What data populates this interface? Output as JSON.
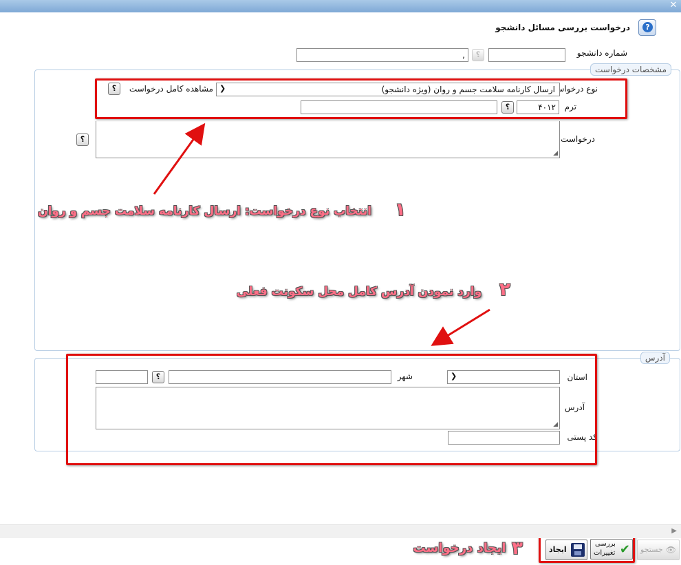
{
  "window": {
    "title": "درخواست بررسی مسائل دانشجو",
    "close_icon": "close-icon"
  },
  "student": {
    "label": "شماره دانشجو",
    "comma": ","
  },
  "request_section": {
    "legend": "مشخصات درخواست",
    "type_label": "نوع درخواست",
    "type_value": "ارسال کارنامه سلامت جسم و روان (ویژه دانشجو)",
    "view_full_label": "مشاهده کامل درخواست",
    "term_label": "ترم",
    "term_value": "۴۰۱۲",
    "first_request_label": "درخواست اول"
  },
  "address_section": {
    "legend": "آدرس",
    "province_label": "استان",
    "city_label": "شهر",
    "address_label": "آدرس",
    "postal_label": "کد پستی"
  },
  "annotations": {
    "step1_num": "۱",
    "step1_text": "انتخاب نوع درخواست: ارسال کارنامه سلامت جسم و روان",
    "step2_num": "۲",
    "step2_text": "وارد نمودن آدرس کامل محل سکونت فعلی",
    "step3_num": "۳",
    "step3_text": "ایجاد درخواست"
  },
  "footer": {
    "search_label": "جستجو",
    "review_label_line1": "بررسی",
    "review_label_line2": "تغییرات",
    "create_label": "ایجاد"
  },
  "colors": {
    "annotation_red": "#e01010",
    "annotation_text": "#ff6f87",
    "titlebar": "#8fb3dc",
    "fieldset_border": "#b7cde4"
  }
}
